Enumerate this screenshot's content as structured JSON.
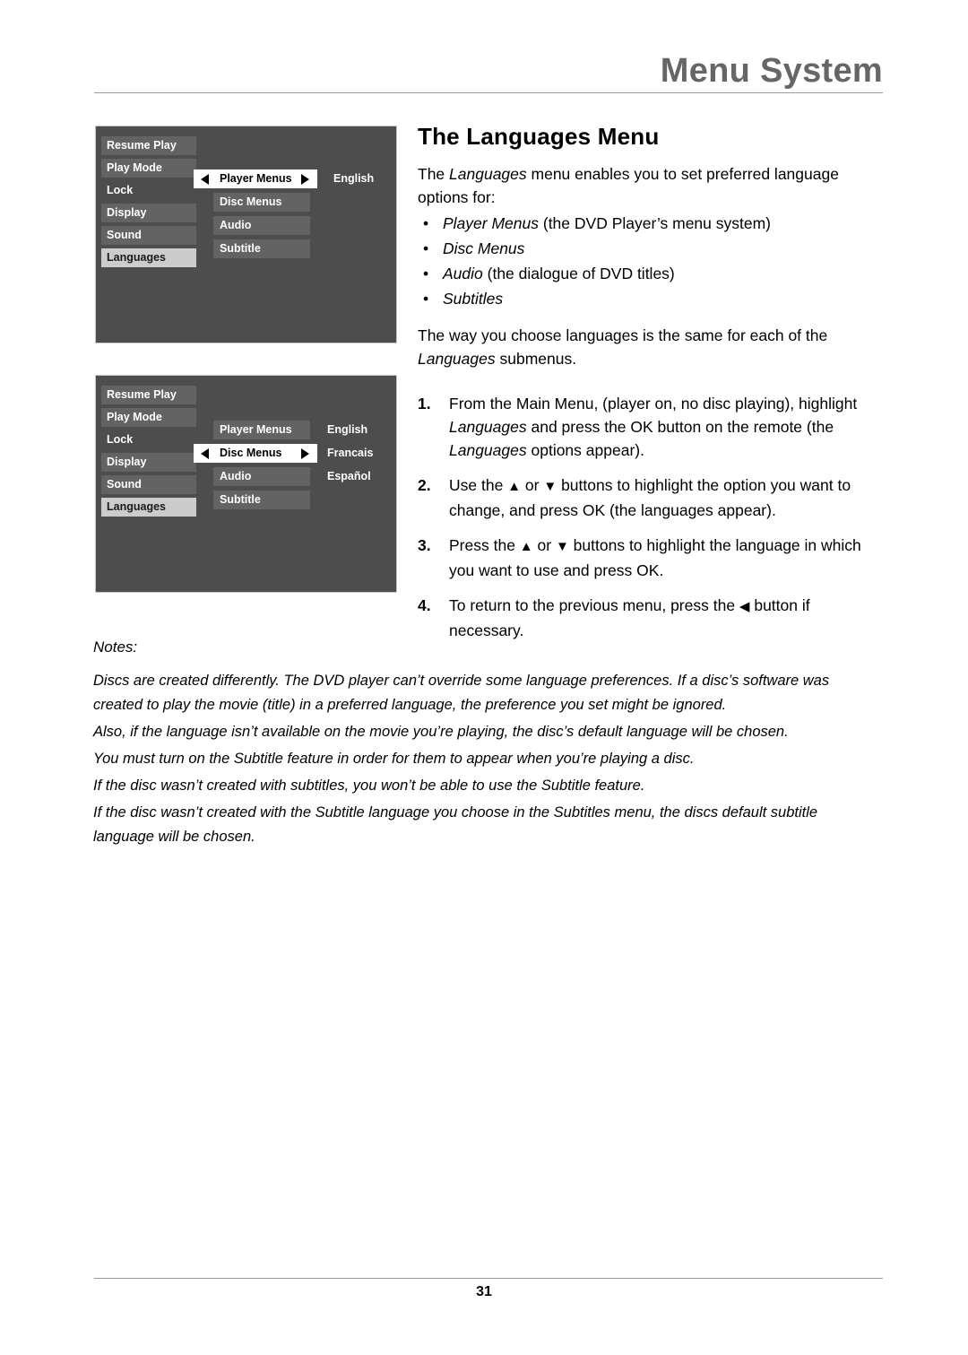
{
  "header": {
    "title": "Menu System",
    "rule_color": "#9a9a9a",
    "title_color": "#666666"
  },
  "osd_menus": [
    {
      "name": "languages-player-menus",
      "sidebar": [
        {
          "label": "Resume Play",
          "style": "shaded",
          "selected": false
        },
        {
          "label": "Play Mode",
          "style": "shaded",
          "selected": false
        },
        {
          "label": "Lock",
          "style": "plain",
          "selected": false
        },
        {
          "label": "Display",
          "style": "shaded",
          "selected": false
        },
        {
          "label": "Sound",
          "style": "shaded",
          "selected": false
        },
        {
          "label": "Languages",
          "style": "selected",
          "selected": true
        }
      ],
      "submenu": [
        {
          "label": "Player Menus",
          "active": true
        },
        {
          "label": "Disc Menus",
          "active": false
        },
        {
          "label": "Audio",
          "active": false
        },
        {
          "label": "Subtitle",
          "active": false
        }
      ],
      "values": [
        "English"
      ]
    },
    {
      "name": "languages-disc-menus",
      "sidebar": [
        {
          "label": "Resume Play",
          "style": "shaded",
          "selected": false
        },
        {
          "label": "Play Mode",
          "style": "shaded",
          "selected": false
        },
        {
          "label": "Lock",
          "style": "plain",
          "selected": false
        },
        {
          "label": "Display",
          "style": "shaded",
          "selected": false
        },
        {
          "label": "Sound",
          "style": "shaded",
          "selected": false
        },
        {
          "label": "Languages",
          "style": "selected",
          "selected": true
        }
      ],
      "submenu": [
        {
          "label": "Player Menus",
          "active": false
        },
        {
          "label": "Disc Menus",
          "active": true
        },
        {
          "label": "Audio",
          "active": false
        },
        {
          "label": "Subtitle",
          "active": false
        }
      ],
      "values": [
        "English",
        "Francais",
        "Español"
      ]
    }
  ],
  "section": {
    "heading": "The Languages Menu",
    "intro_before": "The ",
    "intro_italic": "Languages",
    "intro_after": " menu enables you to set preferred language options for:",
    "bullets": [
      {
        "italic": "Player Menus",
        "rest": " (the DVD Player’s menu system)"
      },
      {
        "italic": "Disc Menus",
        "rest": ""
      },
      {
        "italic": "Audio",
        "rest": " (the dialogue of DVD titles)"
      },
      {
        "italic": "Subtitles",
        "rest": ""
      }
    ],
    "after_bullets_1": "The way you choose languages is the same for each of the ",
    "after_bullets_italic": "Languages",
    "after_bullets_2": " submenus.",
    "steps": [
      {
        "num": "1.",
        "p1": "From the Main Menu, (player on, no disc playing), highlight ",
        "i1": "Languages",
        "p2": " and press the OK button on the remote (the ",
        "i2": "Languages",
        "p3": " options appear)."
      },
      {
        "num": "2.",
        "p1": "Use the ",
        "i1": "▲",
        "p2": " or ",
        "i2": "▼",
        "p3": " buttons to highlight the option you want to change, and press OK (the languages appear)."
      },
      {
        "num": "3.",
        "p1": "Press the ",
        "i1": "▲",
        "p2": " or ",
        "i2": "▼",
        "p3": " buttons to highlight the language in which you want to use and press OK."
      },
      {
        "num": "4.",
        "p1": "To return to the previous menu, press the ",
        "i1": "◀",
        "p2": " button if necessary.",
        "i2": "",
        "p3": ""
      }
    ]
  },
  "notes": {
    "label": "Notes:",
    "paragraphs": [
      "Discs are created differently. The DVD player can’t override some language preferences. If a disc’s software was created to play the movie (title) in a preferred language, the preference you set might be ignored.",
      "Also, if the language isn’t available on the movie you’re playing, the disc’s default language will be chosen.",
      "You must turn on the Subtitle feature in order for them to appear when you’re playing a disc.",
      "If the disc wasn’t created with subtitles, you won’t be able to use the Subtitle feature.",
      "If the disc wasn’t created with the Subtitle language you choose in the Subtitles menu, the discs default subtitle language will be chosen."
    ]
  },
  "footer": {
    "page_number": "31"
  }
}
